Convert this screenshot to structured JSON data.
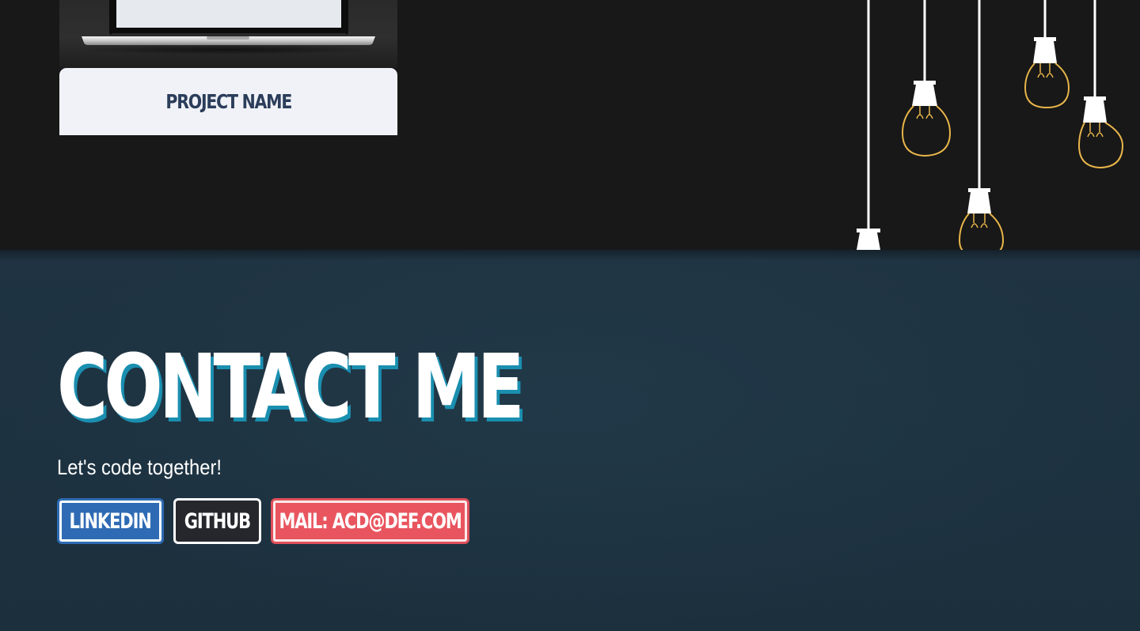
{
  "projects": {
    "card": {
      "name": "Project name"
    }
  },
  "contact": {
    "title": "Contact me",
    "tagline": "Let's code together!",
    "buttons": {
      "linkedin": "LinkedIn",
      "github": "Github",
      "mail": "Mail: acd@def.com"
    }
  },
  "colors": {
    "projects_bg": "#181818",
    "contact_bg": "#1e3241",
    "title_shadow": "#1a8fb0",
    "linkedin": "#2e6bb4",
    "github": "#25272c",
    "mail": "#e9555f",
    "bulb_outline": "#e8b54a"
  },
  "icons": [
    "laptop-image",
    "hanging-bulbs-icon"
  ]
}
